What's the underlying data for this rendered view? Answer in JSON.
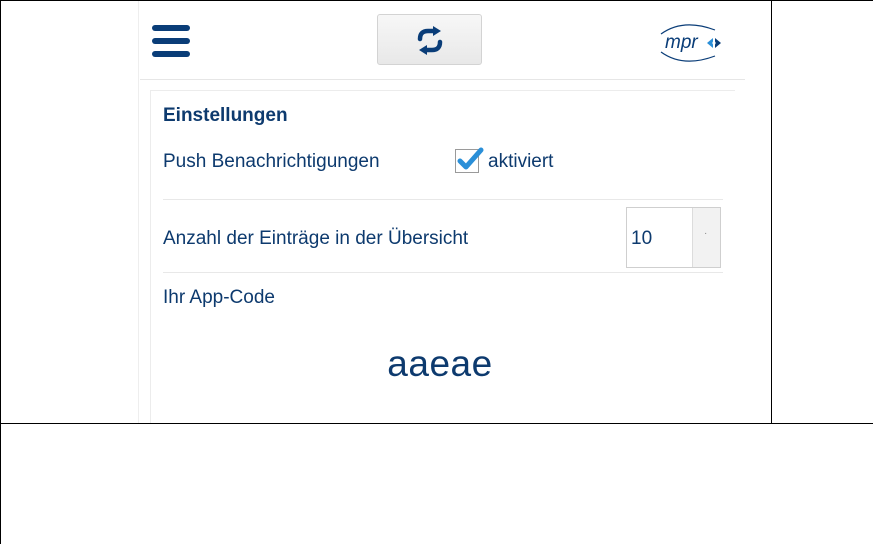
{
  "header": {
    "menu_icon": "hamburger-menu-icon",
    "refresh_icon": "refresh-icon",
    "logo_text": "mpr"
  },
  "settings": {
    "title": "Einstellungen",
    "push": {
      "label": "Push Benachrichtigungen",
      "checked": true,
      "status_text": "aktiviert"
    },
    "entries": {
      "label": "Anzahl der Einträge in der Übersicht",
      "selected_value": "10"
    },
    "app_code": {
      "label": "Ihr App-Code",
      "value": "aaeae"
    }
  },
  "colors": {
    "primary_text": "#0d3a6e",
    "accent": "#2a8fd8",
    "menu": "#0a3d78"
  }
}
